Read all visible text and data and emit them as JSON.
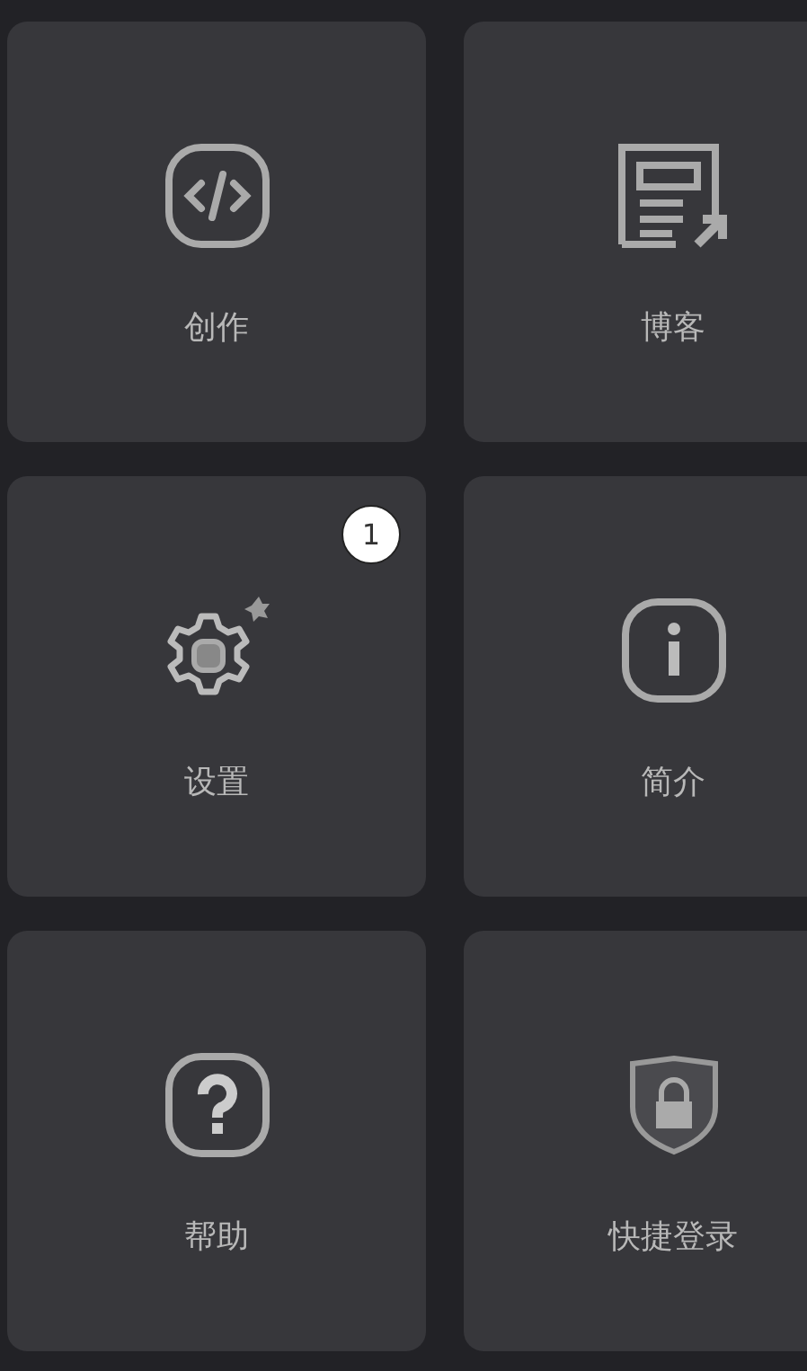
{
  "tiles": [
    {
      "kind": "code",
      "label": "创作"
    },
    {
      "kind": "blog",
      "label": "博客"
    },
    {
      "kind": "settings",
      "label": "设置",
      "badge": "1"
    },
    {
      "kind": "info",
      "label": "简介"
    },
    {
      "kind": "help",
      "label": "帮助"
    },
    {
      "kind": "shield",
      "label": "快捷登录"
    }
  ]
}
